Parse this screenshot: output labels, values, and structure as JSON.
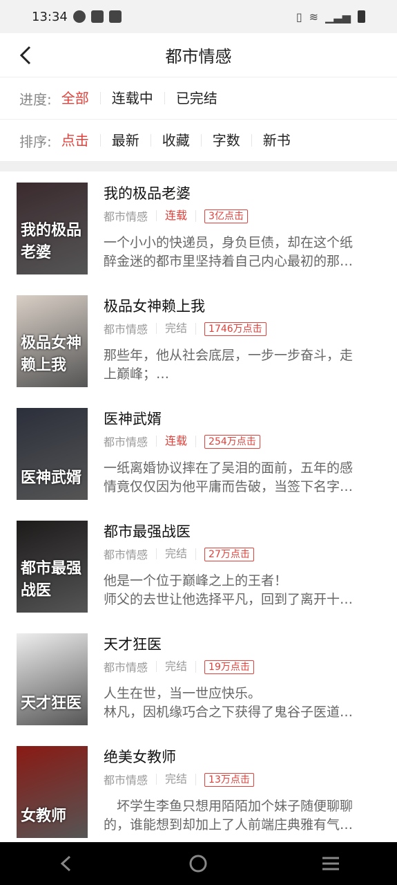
{
  "status": {
    "time": "13:34"
  },
  "header": {
    "title": "都市情感"
  },
  "progress_filter": {
    "label": "进度:",
    "options": [
      "全部",
      "连载中",
      "已完结"
    ],
    "active": "全部"
  },
  "sort_filter": {
    "label": "排序:",
    "options": [
      "点击",
      "最新",
      "收藏",
      "字数",
      "新书"
    ],
    "active": "点击"
  },
  "books": [
    {
      "title": "我的极品老婆",
      "category": "都市情感",
      "status": "连载",
      "status_color": "#e0413b",
      "clicks": "3亿点击",
      "desc1": "一个小小的快递员，身负巨债，却在这个纸",
      "desc2": "醉金迷的都市里坚持着自己内心最初的那…",
      "cover_text": "我的极品老婆",
      "cover_bg": "#3a2a2e"
    },
    {
      "title": "极品女神赖上我",
      "category": "都市情感",
      "status": "完结",
      "status_color": "#999999",
      "clicks": "1746万点击",
      "desc1": "那些年，他从社会底层，一步一步奋斗，走",
      "desc2": "上巅峰；…",
      "cover_text": "极品女神赖上我",
      "cover_bg": "#d9cfc6"
    },
    {
      "title": "医神武婿",
      "category": "都市情感",
      "status": "连载",
      "status_color": "#e0413b",
      "clicks": "254万点击",
      "desc1": "一纸离婚协议摔在了吴泪的面前，五年的感",
      "desc2": "情竟仅仅因为他平庸而告破，当签下名字…",
      "cover_text": "医神武婿",
      "cover_bg": "#2b2f3a"
    },
    {
      "title": "都市最强战医",
      "category": "都市情感",
      "status": "完结",
      "status_color": "#999999",
      "clicks": "27万点击",
      "desc1": "他是一个位于巅峰之上的王者！",
      "desc2": "师父的去世让他选择平凡，回到了离开十…",
      "cover_text": "都市最强战医",
      "cover_bg": "#1d1a1a"
    },
    {
      "title": "天才狂医",
      "category": "都市情感",
      "status": "完结",
      "status_color": "#999999",
      "clicks": "19万点击",
      "desc1": "人生在世，当一世应快乐。",
      "desc2": "林凡，因机缘巧合之下获得了鬼谷子医道…",
      "cover_text": "天才狂医",
      "cover_bg": "#eeeeee"
    },
    {
      "title": "绝美女教师",
      "category": "都市情感",
      "status": "完结",
      "status_color": "#999999",
      "clicks": "13万点击",
      "desc1": "　坏学生李鱼只想用陌陌加个妹子随便聊聊",
      "desc2": "的，谁能想到却加上了人前端庄典雅有气…",
      "cover_text": "女教师",
      "cover_bg": "#8a1a14"
    }
  ],
  "icons": {
    "back": "chevron-left-icon",
    "nav_back": "triangle-back-icon",
    "nav_home": "circle-home-icon",
    "nav_menu": "menu-icon"
  }
}
